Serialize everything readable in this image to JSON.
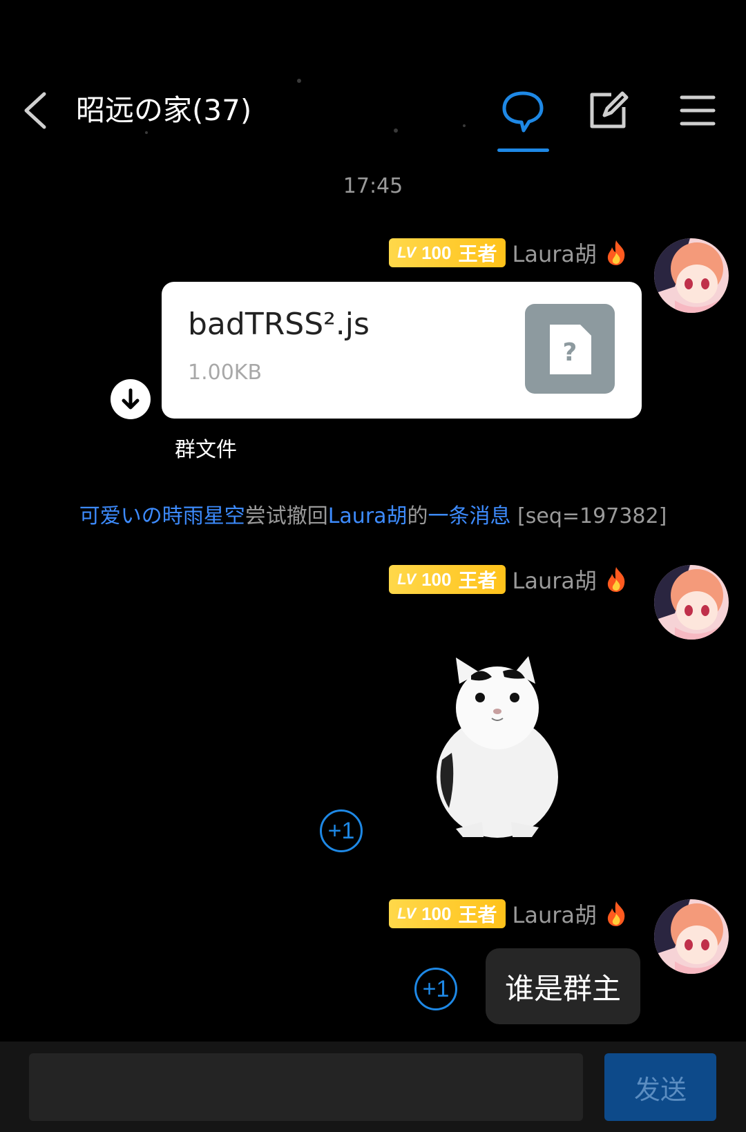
{
  "header": {
    "title": "昭远の家(37)",
    "icons": [
      "back-icon",
      "chat-bubble-icon",
      "edit-icon",
      "menu-icon"
    ]
  },
  "time_divider": "17:45",
  "sender": {
    "level": "100",
    "level_prefix": "LV",
    "rank": "王者",
    "name": "Laura胡",
    "badge_icon": "fire-icon"
  },
  "file_message": {
    "file_name": "badTRSS².js",
    "file_size": "1.00KB",
    "source_label": "群文件",
    "thumb_symbol": "?"
  },
  "system_message": {
    "actor": "可爱いの時雨星空",
    "action1": "尝试撤回",
    "target": "Laura胡",
    "action2": "的",
    "link": "一条消息",
    "suffix": " [seq=197382]"
  },
  "sticker": {
    "description_icon": "cat-sticker"
  },
  "plus_one_label": "+1",
  "text_message": "谁是群主",
  "composer": {
    "send_label": "发送",
    "input_value": ""
  },
  "colors": {
    "accent": "#1e88e5",
    "link": "#3d8bfd",
    "level_badge": "#ffc21a",
    "send_button": "#0d4a8a"
  }
}
